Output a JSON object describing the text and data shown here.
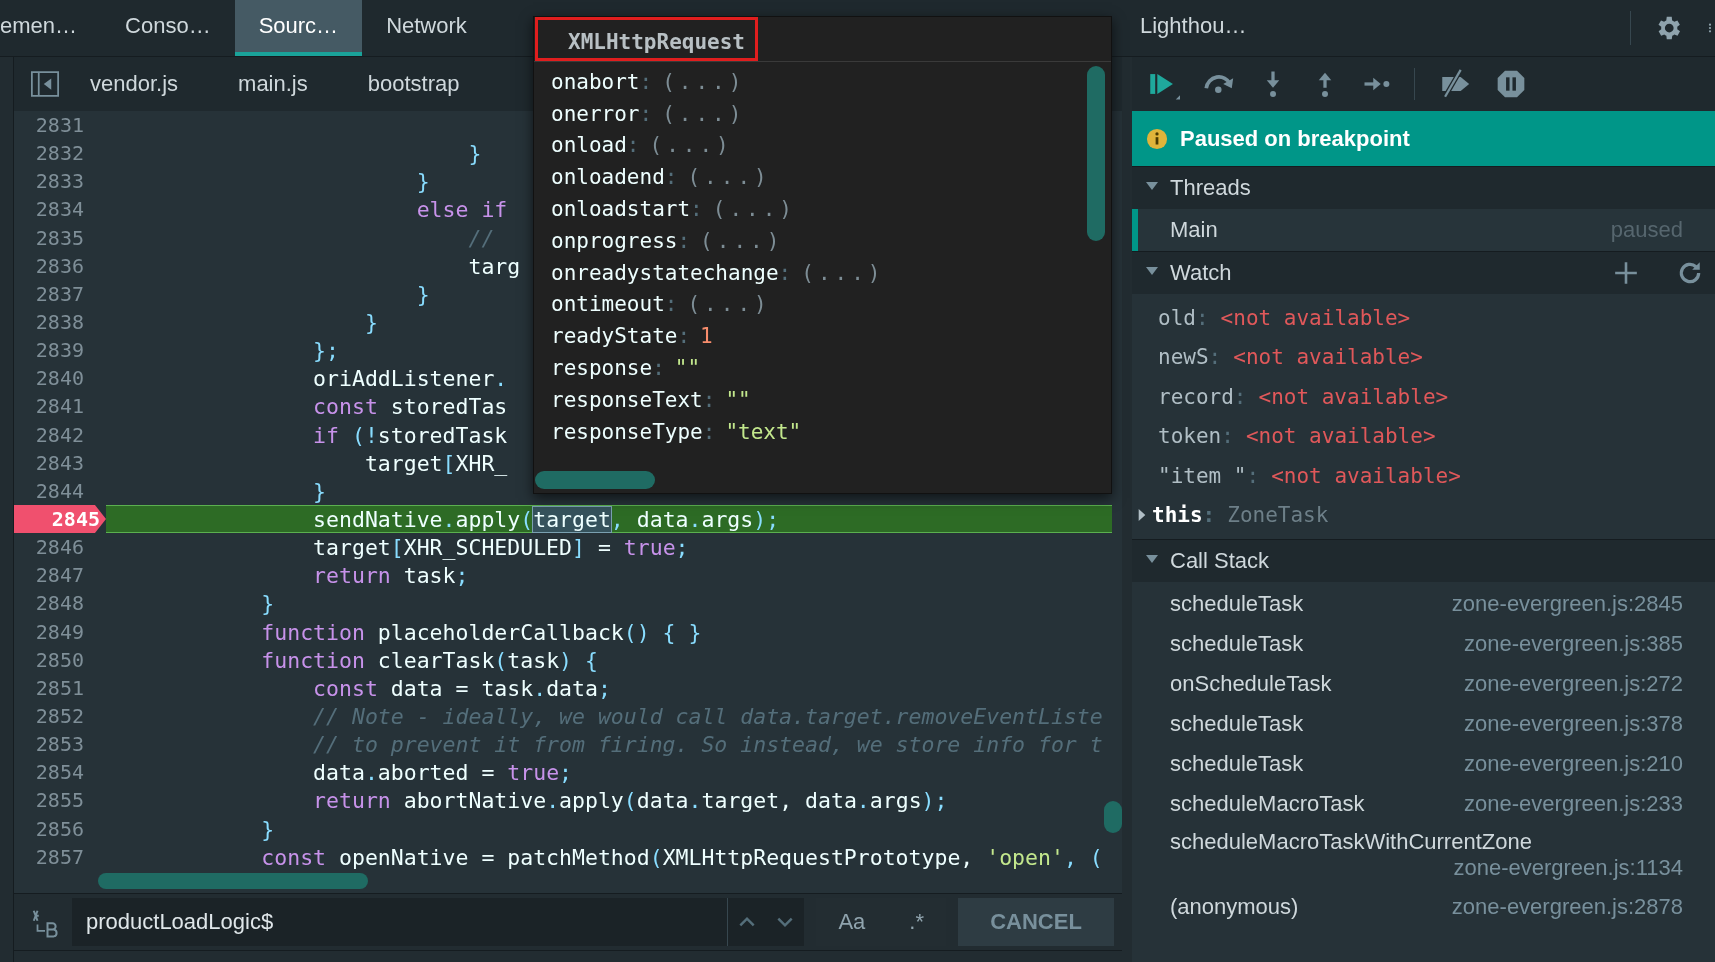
{
  "top_tabs": [
    {
      "label": "emen…",
      "selected": false
    },
    {
      "label": "Conso…",
      "selected": false
    },
    {
      "label": "Sourc…",
      "selected": true
    },
    {
      "label": "Network",
      "selected": false
    },
    {
      "label": "Lighthou…",
      "selected": false
    }
  ],
  "file_tabs": [
    "vendor.js",
    "main.js",
    "bootstrap"
  ],
  "code": {
    "lines": [
      {
        "number": "2831"
      },
      {
        "number": "2832",
        "tokens": [
          {
            "kind": "punct",
            "text": "                            }"
          }
        ]
      },
      {
        "number": "2833",
        "tokens": [
          {
            "kind": "punct",
            "text": "                        }"
          }
        ]
      },
      {
        "number": "2834",
        "tokens": [
          {
            "kind": "kw",
            "text": "                        else if"
          }
        ]
      },
      {
        "number": "2835",
        "tokens": [
          {
            "kind": "comment",
            "text": "                            //"
          }
        ]
      },
      {
        "number": "2836",
        "tokens": [
          {
            "kind": "text",
            "text": "                            targ"
          }
        ]
      },
      {
        "number": "2837",
        "tokens": [
          {
            "kind": "punct",
            "text": "                        }"
          }
        ]
      },
      {
        "number": "2838",
        "tokens": [
          {
            "kind": "punct",
            "text": "                    }"
          }
        ]
      },
      {
        "number": "2839",
        "tokens": [
          {
            "kind": "punct",
            "text": "                };"
          }
        ]
      },
      {
        "number": "2840",
        "tokens": [
          {
            "kind": "text",
            "text": "                oriAddListener"
          },
          {
            "kind": "punct",
            "text": "."
          }
        ]
      },
      {
        "number": "2841",
        "tokens": [
          {
            "kind": "kw",
            "text": "                const"
          },
          {
            "kind": "text",
            "text": " storedTas"
          }
        ]
      },
      {
        "number": "2842",
        "tokens": [
          {
            "kind": "kw",
            "text": "                if"
          },
          {
            "kind": "punct",
            "text": " (!"
          },
          {
            "kind": "text",
            "text": "storedTask"
          }
        ]
      },
      {
        "number": "2843",
        "tokens": [
          {
            "kind": "text",
            "text": "                    target"
          },
          {
            "kind": "punct",
            "text": "["
          },
          {
            "kind": "text",
            "text": "XHR_"
          }
        ]
      },
      {
        "number": "2844",
        "tokens": [
          {
            "kind": "punct",
            "text": "                }"
          }
        ]
      },
      {
        "number": "2845",
        "breakpoint": true,
        "current": true,
        "tokens": [
          {
            "kind": "text",
            "text": "                sendNative"
          },
          {
            "kind": "punct",
            "text": "."
          },
          {
            "kind": "text",
            "text": "apply"
          },
          {
            "kind": "punct",
            "text": "("
          },
          {
            "kind": "match",
            "text": "target"
          },
          {
            "kind": "punct",
            "text": ", "
          },
          {
            "kind": "text",
            "text": "data"
          },
          {
            "kind": "punct",
            "text": "."
          },
          {
            "kind": "text",
            "text": "args"
          },
          {
            "kind": "punct",
            "text": ");"
          }
        ]
      },
      {
        "number": "2846",
        "breakpoint": false,
        "current": false,
        "tokens": [
          {
            "kind": "text",
            "text": "                target"
          },
          {
            "kind": "punct",
            "text": "["
          },
          {
            "kind": "text",
            "text": "XHR_SCHEDULED"
          },
          {
            "kind": "punct",
            "text": "]"
          },
          {
            "kind": "text",
            "text": " = "
          },
          {
            "kind": "bool",
            "text": "true"
          },
          {
            "kind": "punct",
            "text": ";"
          }
        ]
      },
      {
        "number": "2847",
        "tokens": [
          {
            "kind": "kw",
            "text": "                return"
          },
          {
            "kind": "text",
            "text": " task"
          },
          {
            "kind": "punct",
            "text": ";"
          }
        ]
      },
      {
        "number": "2848",
        "tokens": [
          {
            "kind": "punct",
            "text": "            }"
          }
        ]
      },
      {
        "number": "2849",
        "tokens": [
          {
            "kind": "kw",
            "text": "            function"
          },
          {
            "kind": "text",
            "text": " placeholderCallback"
          },
          {
            "kind": "punct",
            "text": "() { }"
          }
        ]
      },
      {
        "number": "2850",
        "tokens": [
          {
            "kind": "kw",
            "text": "            function"
          },
          {
            "kind": "text",
            "text": " clearTask"
          },
          {
            "kind": "punct",
            "text": "("
          },
          {
            "kind": "text",
            "text": "task"
          },
          {
            "kind": "punct",
            "text": ") {"
          }
        ]
      },
      {
        "number": "2851",
        "tokens": [
          {
            "kind": "kw",
            "text": "                const"
          },
          {
            "kind": "text",
            "text": " data = task"
          },
          {
            "kind": "punct",
            "text": "."
          },
          {
            "kind": "text",
            "text": "data"
          },
          {
            "kind": "punct",
            "text": ";"
          }
        ]
      },
      {
        "number": "2852",
        "tokens": [
          {
            "kind": "comment",
            "text": "                // Note - ideally, we would call data.target.removeEventListe"
          }
        ]
      },
      {
        "number": "2853",
        "tokens": [
          {
            "kind": "comment",
            "text": "                // to prevent it from firing. So instead, we store info for t"
          }
        ]
      },
      {
        "number": "2854",
        "tokens": [
          {
            "kind": "text",
            "text": "                data"
          },
          {
            "kind": "punct",
            "text": "."
          },
          {
            "kind": "text",
            "text": "aborted = "
          },
          {
            "kind": "bool",
            "text": "true"
          },
          {
            "kind": "punct",
            "text": ";"
          }
        ]
      },
      {
        "number": "2855",
        "tokens": [
          {
            "kind": "kw",
            "text": "                return"
          },
          {
            "kind": "text",
            "text": " abortNative"
          },
          {
            "kind": "punct",
            "text": "."
          },
          {
            "kind": "text",
            "text": "apply"
          },
          {
            "kind": "punct",
            "text": "("
          },
          {
            "kind": "text",
            "text": "data"
          },
          {
            "kind": "punct",
            "text": "."
          },
          {
            "kind": "text",
            "text": "target, data"
          },
          {
            "kind": "punct",
            "text": "."
          },
          {
            "kind": "text",
            "text": "args"
          },
          {
            "kind": "punct",
            "text": ");"
          }
        ]
      },
      {
        "number": "2856",
        "tokens": [
          {
            "kind": "punct",
            "text": "            }"
          }
        ]
      },
      {
        "number": "2857",
        "tokens": [
          {
            "kind": "kw",
            "text": "            const"
          },
          {
            "kind": "text",
            "text": " openNative = patchMethod"
          },
          {
            "kind": "punct",
            "text": "("
          },
          {
            "kind": "text",
            "text": "XMLHttpRequestPrototype, "
          },
          {
            "kind": "string",
            "text": "'open'"
          },
          {
            "kind": "punct",
            "text": ", ("
          }
        ]
      }
    ]
  },
  "popup": {
    "title": "XMLHttpRequest",
    "separator": ":",
    "properties": [
      {
        "name": "onabort",
        "value": "(...)",
        "kind": "fn"
      },
      {
        "name": "onerror",
        "value": "(...)",
        "kind": "fn"
      },
      {
        "name": "onload",
        "value": "(...)",
        "kind": "fn"
      },
      {
        "name": "onloadend",
        "value": "(...)",
        "kind": "fn"
      },
      {
        "name": "onloadstart",
        "value": "(...)",
        "kind": "fn"
      },
      {
        "name": "onprogress",
        "value": "(...)",
        "kind": "fn"
      },
      {
        "name": "onreadystatechange",
        "value": "(...)",
        "kind": "fn"
      },
      {
        "name": "ontimeout",
        "value": "(...)",
        "kind": "fn"
      },
      {
        "name": "readyState",
        "value": "1",
        "kind": "number"
      },
      {
        "name": "response",
        "value": "\"\"",
        "kind": "string"
      },
      {
        "name": "responseText",
        "value": "\"\"",
        "kind": "string"
      },
      {
        "name": "responseType",
        "value": "\"text\"",
        "kind": "string"
      }
    ]
  },
  "debugger": {
    "banner": "Paused on breakpoint",
    "threads": {
      "title": "Threads",
      "expanded": true,
      "items": [
        {
          "name": "Main",
          "status": "paused",
          "selected": true
        }
      ]
    },
    "watch": {
      "title": "Watch",
      "expanded": true,
      "separator": ":",
      "items": [
        {
          "name": "old",
          "value": "<not available>",
          "kind": "unavailable"
        },
        {
          "name": "newS",
          "value": "<not available>",
          "kind": "unavailable"
        },
        {
          "name": "record",
          "value": "<not available>",
          "kind": "unavailable"
        },
        {
          "name": "token",
          "value": "<not available>",
          "kind": "unavailable"
        },
        {
          "name": "\"item \"",
          "value": "<not available>",
          "kind": "unavailable"
        },
        {
          "name": "this",
          "value": "ZoneTask",
          "kind": "object",
          "expanded": false
        }
      ]
    },
    "call_stack": {
      "title": "Call Stack",
      "expanded": true,
      "frames": [
        {
          "name": "scheduleTask",
          "location": "zone-evergreen.js:2845"
        },
        {
          "name": "scheduleTask",
          "location": "zone-evergreen.js:385"
        },
        {
          "name": "onScheduleTask",
          "location": "zone-evergreen.js:272"
        },
        {
          "name": "scheduleTask",
          "location": "zone-evergreen.js:378"
        },
        {
          "name": "scheduleTask",
          "location": "zone-evergreen.js:210"
        },
        {
          "name": "scheduleMacroTask",
          "location": "zone-evergreen.js:233"
        },
        {
          "name": "scheduleMacroTaskWithCurrentZone",
          "location": "zone-evergreen.js:1134"
        },
        {
          "name": "(anonymous)",
          "location": "zone-evergreen.js:2878"
        }
      ]
    }
  },
  "search": {
    "value": "productLoadLogic$",
    "case_toggle": "Aa",
    "regex_toggle": ".*",
    "cancel": "CANCEL"
  }
}
